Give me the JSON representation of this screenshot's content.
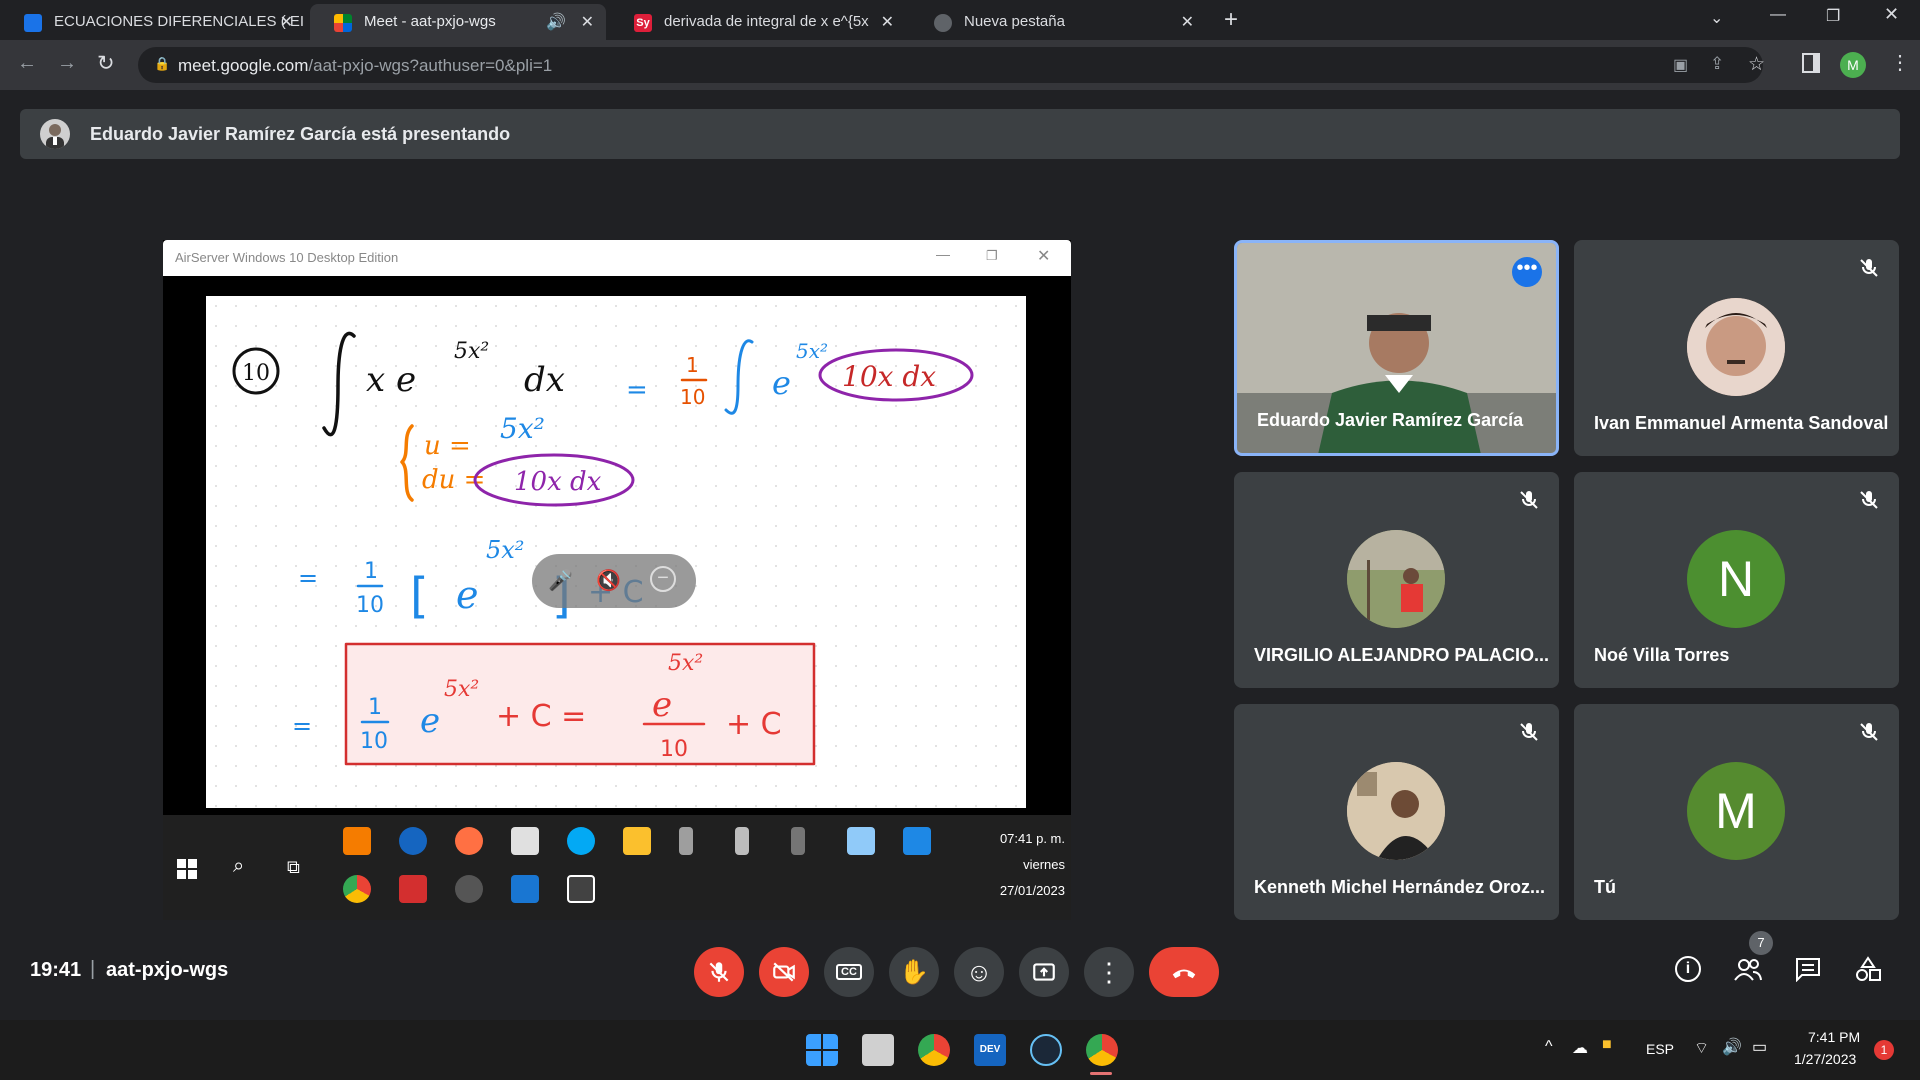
{
  "tabs": [
    {
      "title": "ECUACIONES DIFERENCIALES ( EI",
      "favicon_color": "#1a73e8"
    },
    {
      "title": "Meet - aat-pxjo-wgs",
      "favicon_color": "#00832d"
    },
    {
      "title": "derivada de integral de x e^{5x^",
      "favicon_color": "#dd1f3a",
      "favicon_text": "Sy"
    },
    {
      "title": "Nueva pestaña",
      "favicon_color": "#5f6368"
    }
  ],
  "address": {
    "domain": "meet.google.com",
    "path": "/aat-pxjo-wgs?authuser=0&pli=1"
  },
  "profile_initial": "M",
  "banner": {
    "text": "Eduardo Javier Ramírez García está presentando"
  },
  "airserver": {
    "title": "AirServer Windows 10 Desktop Edition",
    "clock": {
      "time": "07:41 p. m.",
      "day": "viernes",
      "date": "27/01/2023"
    }
  },
  "whiteboard": {
    "problem_number": "10",
    "subst_u": "u = 5x²",
    "subst_du": "du = 10x dx",
    "final_note": "= 1/10 e^{5x²} + C = e^{5x²}/10 + C"
  },
  "participants": [
    {
      "name": "Eduardo Javier Ramírez García",
      "speaking": true
    },
    {
      "name": "Ivan Emmanuel Armenta Sandoval"
    },
    {
      "name": "VIRGILIO ALEJANDRO PALACIO..."
    },
    {
      "name": "Noé Villa Torres",
      "initial": "N",
      "color": "#4c8f30"
    },
    {
      "name": "Kenneth Michel Hernández Oroz..."
    },
    {
      "name": "Tú",
      "initial": "M",
      "color": "#558b2f"
    }
  ],
  "meeting": {
    "time": "19:41",
    "separator": "|",
    "code": "aat-pxjo-wgs",
    "participant_count": "7"
  },
  "taskbar": {
    "lang": "ESP",
    "time": "7:41 PM",
    "date": "1/27/2023",
    "notifications": "1"
  }
}
